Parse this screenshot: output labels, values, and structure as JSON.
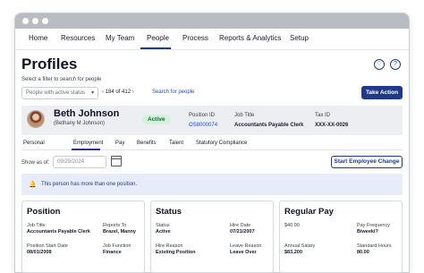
{
  "nav": {
    "items": [
      "Home",
      "Resources",
      "My Team",
      "People",
      "Process",
      "Reports & Analytics",
      "Setup"
    ],
    "active": "People"
  },
  "page": {
    "title": "Profiles",
    "hint": "Select a filter to search for people"
  },
  "toolbar": {
    "filter_placeholder": "People with active status",
    "pager_text": "184 of 412",
    "search_link": "Search for people",
    "take_action": "Take Action"
  },
  "employee": {
    "name": "Beth Johnson",
    "alt_name": "(Bethany M Johnson)",
    "status": "Active",
    "position_id_label": "Position ID",
    "position_id": "OS8000074",
    "job_title_label": "Job Title",
    "job_title": "Accountants Payable Clerk",
    "tax_id_label": "Tax ID",
    "tax_id": "XXX-XX-0026"
  },
  "tabs": [
    "Personal",
    "Employment",
    "Pay",
    "Benefits",
    "Talent",
    "Statutory Compliance"
  ],
  "active_tab": "Employment",
  "show_as": {
    "label": "Show as of:",
    "placeholder": "09/29/2024"
  },
  "start_change": "Start Employee Change",
  "alert": {
    "text": "This person has more than one position."
  },
  "cards": {
    "position": {
      "title": "Position",
      "fields": [
        {
          "label": "Job Title",
          "value": "Accountants Payable Clerk"
        },
        {
          "label": "Reports To",
          "value": "Brazel, Manny"
        },
        {
          "label": "Position Start Date",
          "value": "08/01/2008"
        },
        {
          "label": "Job Function",
          "value": "Finance"
        }
      ]
    },
    "status": {
      "title": "Status",
      "fields": [
        {
          "label": "Status",
          "value": "Active"
        },
        {
          "label": "Hire Date",
          "value": "07/21/2007"
        },
        {
          "label": "Hire Reason",
          "value": "Existing Position"
        },
        {
          "label": "Leave Reason",
          "value": "Leave Over"
        }
      ]
    },
    "pay": {
      "title": "Regular Pay",
      "fields": [
        {
          "label": "$40.00",
          "value": ""
        },
        {
          "label": "Pay Frequency",
          "value": "Biweekl?"
        },
        {
          "label": "Annual Salary",
          "value": "$83,200"
        },
        {
          "label": "Standard Hours",
          "value": "80.00"
        }
      ]
    }
  },
  "colors": {
    "accent": "#1f3a8a",
    "link": "#1f4fd1",
    "active_badge_bg": "#d4f1dc",
    "alert_bg": "#e6ecf9"
  }
}
